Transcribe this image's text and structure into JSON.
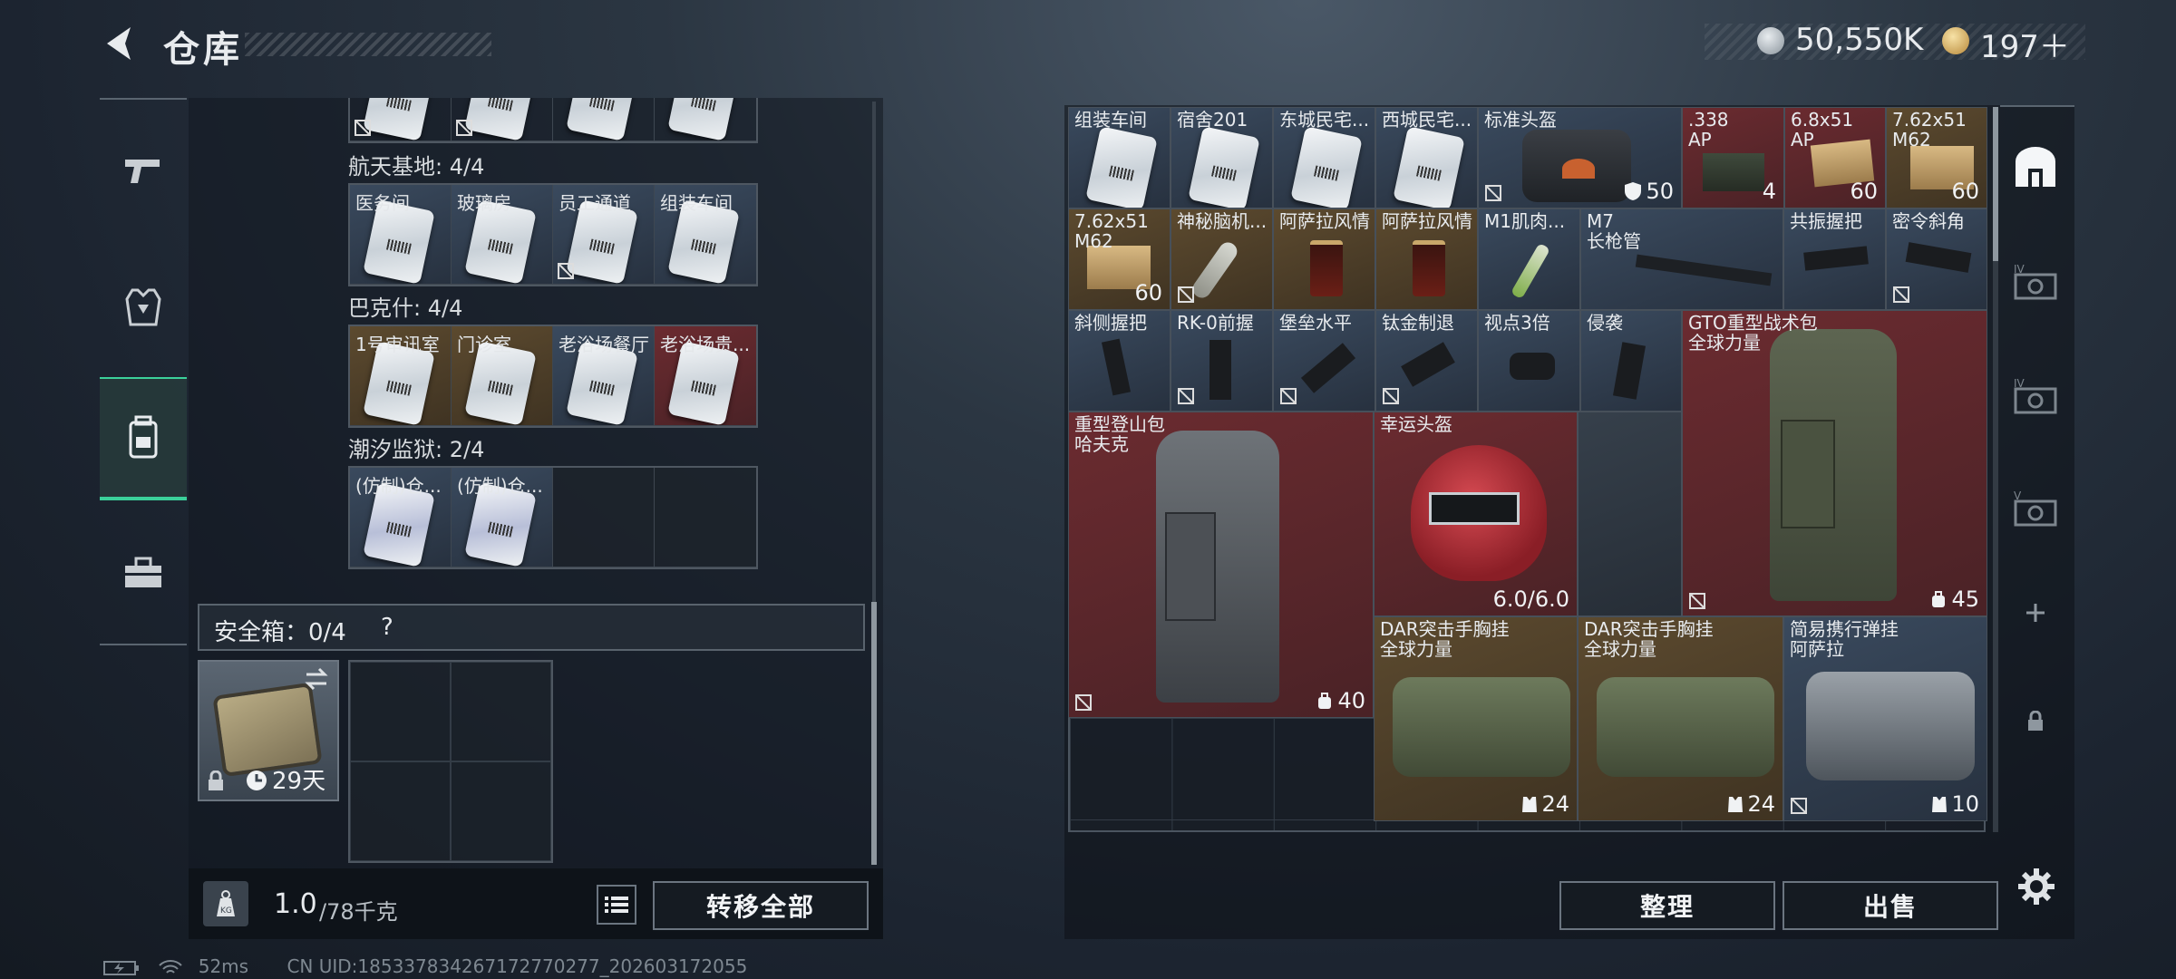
{
  "header": {
    "title": "仓库",
    "silver": "50,550K",
    "gold": "197＋"
  },
  "colors": {
    "accent": "#3bd09a",
    "panel": "#121820",
    "red_cell": "#6b2b30",
    "gold_cell": "#5c4a2f"
  },
  "left_nav": [
    {
      "icon": "pistol-icon"
    },
    {
      "icon": "armor-vest-icon"
    },
    {
      "icon": "backpack-icon"
    },
    {
      "icon": "toolbox-icon"
    }
  ],
  "sections": [
    {
      "name": "航天基地: 4/4",
      "cells": [
        "医务间",
        "玻璃房",
        "员工通道",
        "组装车间"
      ]
    },
    {
      "name": "巴克什: 4/4",
      "cells": [
        "1号审讯室",
        "门诊室",
        "老浴场餐厅",
        "老浴场贵..."
      ]
    },
    {
      "name": "潮汐监狱: 2/4",
      "cells": [
        "(仿制)仓...",
        "(仿制)仓..."
      ]
    }
  ],
  "safebox": {
    "label": "安全箱：0/4",
    "help": "?",
    "days": "29天"
  },
  "weight": {
    "value": "1.0",
    "max": "/78千克",
    "transfer": "转移全部"
  },
  "stash_items": [
    {
      "name": "组装车间",
      "count": ""
    },
    {
      "name": "宿舍201",
      "count": ""
    },
    {
      "name": "东城民宅...",
      "count": ""
    },
    {
      "name": "西城民宅...",
      "count": ""
    },
    {
      "name": "标准头盔",
      "count": "50"
    },
    {
      "name": ".338\nAP",
      "count": "4"
    },
    {
      "name": "6.8x51\nAP",
      "count": "60"
    },
    {
      "name": "7.62x51\nM62",
      "count": "60"
    },
    {
      "name": "7.62x51\nM62",
      "count": "60"
    },
    {
      "name": "神秘脑机...",
      "count": ""
    },
    {
      "name": "阿萨拉风情",
      "count": ""
    },
    {
      "name": "阿萨拉风情",
      "count": ""
    },
    {
      "name": "M1肌肉...",
      "count": ""
    },
    {
      "name": "M7\n长枪管",
      "count": ""
    },
    {
      "name": "共振握把",
      "count": ""
    },
    {
      "name": "密令斜角",
      "count": ""
    },
    {
      "name": "斜侧握把",
      "count": ""
    },
    {
      "name": "RK-0前握",
      "count": ""
    },
    {
      "name": "堡垒水平",
      "count": ""
    },
    {
      "name": "钛金制退",
      "count": ""
    },
    {
      "name": "视点3倍",
      "count": ""
    },
    {
      "name": "侵袭",
      "count": ""
    },
    {
      "name": "GTO重型战术包\n全球力量",
      "count": "45"
    },
    {
      "name": "重型登山包\n哈夫克",
      "count": "40"
    },
    {
      "name": "幸运头盔",
      "count": "6.0/6.0"
    },
    {
      "name": "DAR突击手胸挂\n全球力量",
      "count": "24"
    },
    {
      "name": "DAR突击手胸挂\n全球力量",
      "count": "24"
    },
    {
      "name": "简易携行弹挂\n阿萨拉",
      "count": "10"
    }
  ],
  "buttons": {
    "sort": "整理",
    "sell": "出售"
  },
  "status": {
    "ping": "52ms",
    "uid": "CN UID:185337834267172770277_202603172055"
  }
}
